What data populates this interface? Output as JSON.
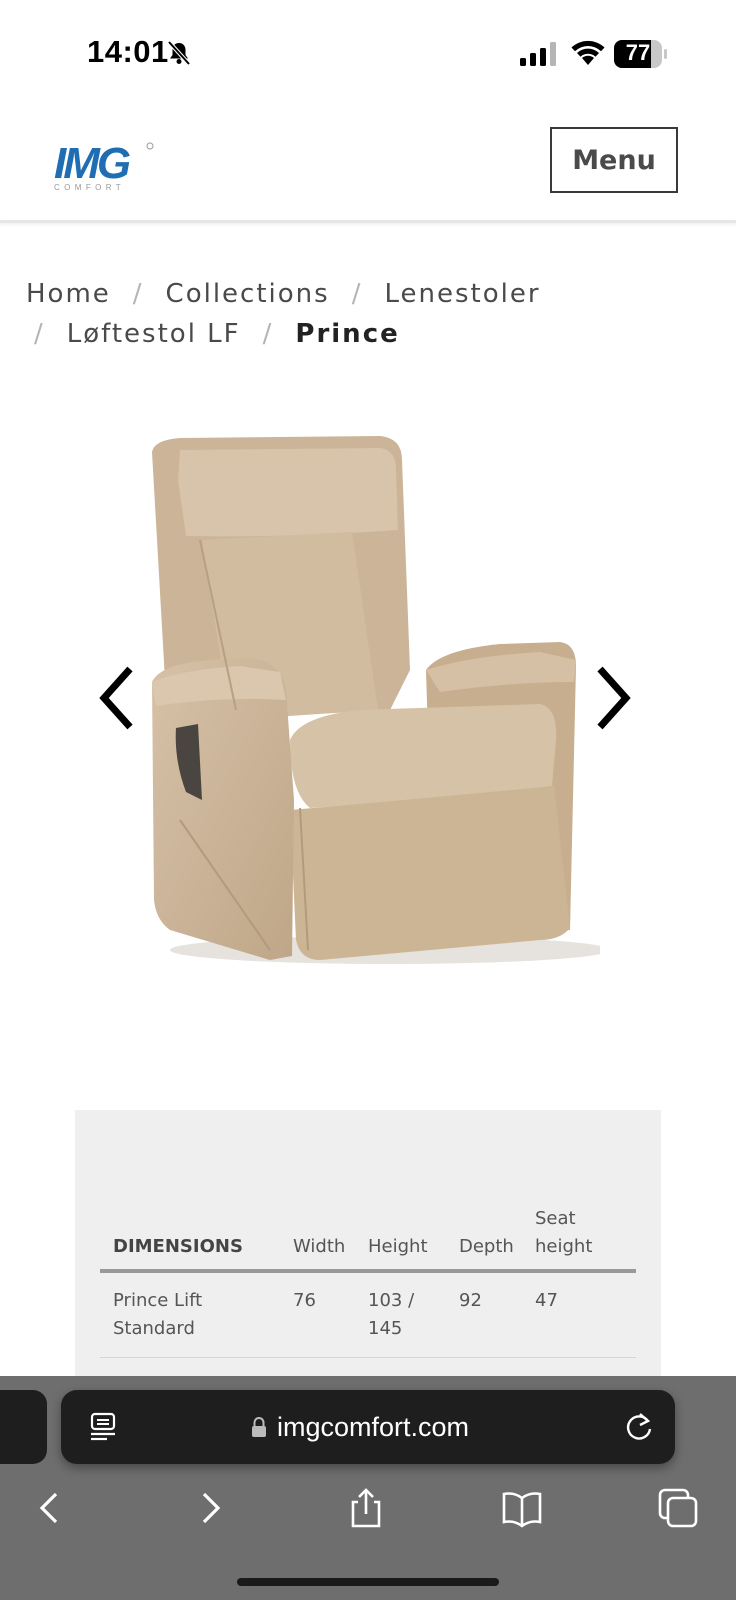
{
  "status_bar": {
    "time": "14:01",
    "battery": "77"
  },
  "header": {
    "logo_text": "IMG",
    "logo_subtext": "COMFORT",
    "menu_label": "Menu"
  },
  "breadcrumb": {
    "items": [
      "Home",
      "Collections",
      "Lenestoler",
      "Løftestol LF"
    ],
    "current": "Prince",
    "separator": "/"
  },
  "product": {
    "image_alt": "Prince recliner chair, beige leather"
  },
  "dimensions": {
    "headers": [
      "DIMENSIONS",
      "Width",
      "Height",
      "Depth",
      "Seat height"
    ],
    "header_lines": {
      "height_label": "Height",
      "seat_line1": "Seat",
      "seat_line2": "height"
    },
    "rows": [
      {
        "name_line1": "Prince Lift",
        "name_line2": "Standard",
        "width": "76",
        "height_line1": "103 /",
        "height_line2": "145",
        "depth": "92",
        "seat_height": "47"
      }
    ]
  },
  "browser": {
    "url": "imgcomfort.com"
  },
  "icons": [
    "bell-slash-icon",
    "signal-icon",
    "wifi-icon",
    "battery-icon",
    "chevron-left-icon",
    "chevron-right-icon",
    "reader-icon",
    "lock-icon",
    "reload-icon",
    "back-icon",
    "forward-icon",
    "share-icon",
    "bookmarks-icon",
    "tabs-icon"
  ],
  "colors": {
    "chair": "#cdb79c",
    "panel_bg": "#efefef",
    "browser_bar": "#6e6e6e",
    "logo_blue": "#1f6db2",
    "logo_gray": "#9a9a9a"
  }
}
